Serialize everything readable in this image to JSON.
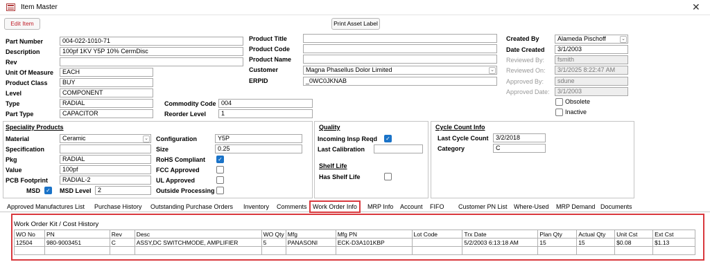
{
  "window": {
    "title": "Item Master",
    "close_icon": "close-icon"
  },
  "buttons": {
    "edit": "Edit Item",
    "print": "Print Asset Label"
  },
  "item": {
    "part_number_label": "Part Number",
    "part_number": "004-022-1010-71",
    "description_label": "Description",
    "description": "100pf 1KV Y5P 10% CermDisc",
    "rev_label": "Rev",
    "rev": "",
    "uom_label": "Unit Of Measure",
    "uom": "EACH",
    "product_class_label": "Product Class",
    "product_class": "BUY",
    "level_label": "Level",
    "level": "COMPONENT",
    "type_label": "Type",
    "type": "RADIAL",
    "part_type_label": "Part Type",
    "part_type": "CAPACITOR",
    "commodity_code_label": "Commodity Code",
    "commodity_code": "004",
    "reorder_level_label": "Reorder Level",
    "reorder_level": "1"
  },
  "product": {
    "title_label": "Product Title",
    "title": "",
    "code_label": "Product Code",
    "code": "",
    "name_label": "Product Name",
    "name": "",
    "customer_label": "Customer",
    "customer": "Magna Phasellus Dolor Limited",
    "erpid_label": "ERPID",
    "erpid": "_0WC0JKNAB"
  },
  "audit": {
    "created_by_label": "Created By",
    "created_by": "Alameda Pischoff",
    "date_created_label": "Date Created",
    "date_created": "3/1/2003",
    "reviewed_by_label": "Reviewed By:",
    "reviewed_by": "fsmith",
    "reviewed_on_label": "Reviewed On:",
    "reviewed_on": "3/1/2025 8:22:47 AM",
    "approved_by_label": "Approved By:",
    "approved_by": "sdune",
    "approved_date_label": "Approved Date:",
    "approved_date": "3/1/2003",
    "obsolete_label": "Obsolete",
    "inactive_label": "Inactive"
  },
  "speciality": {
    "heading": "Speciality Products",
    "material_label": "Material",
    "material": "Ceramic",
    "specification_label": "Specification",
    "specification": "",
    "pkg_label": "Pkg",
    "pkg": "RADIAL",
    "value_label": "Value",
    "value": "100pf",
    "pcb_label": "PCB Footprint",
    "pcb": "RADIAL-2",
    "msd_label": "MSD",
    "msd_level_label": "MSD Level",
    "msd_level": "2",
    "configuration_label": "Configuration",
    "configuration": "Y5P",
    "size_label": "Size",
    "size": "0.25",
    "rohs_label": "RoHS Compliant",
    "fcc_label": "FCC Approved",
    "ul_label": "UL Approved",
    "outside_label": "Outside Processing"
  },
  "quality": {
    "heading": "Quality",
    "incoming_label": "Incoming Insp Reqd",
    "last_calibration_label": "Last Calibration",
    "last_calibration": "",
    "shelf_heading": "Shelf Life",
    "has_shelf_label": "Has Shelf Life"
  },
  "cycle": {
    "heading": "Cycle Count Info",
    "last_count_label": "Last Cycle Count",
    "last_count": "3/2/2018",
    "category_label": "Category",
    "category": "C"
  },
  "tabs": {
    "t0": "Approved Manufactures List",
    "t1": "Purchase History",
    "t2": "Outstanding Purchase Orders",
    "t3": "Inventory",
    "t4": "Comments",
    "t5": "Work Order Info",
    "t6": "MRP Info",
    "t7": "Account",
    "t8": "FIFO",
    "t9": "Customer PN List",
    "t10": "Where-Used",
    "t11": "MRP Demand",
    "t12": "Documents"
  },
  "work_order": {
    "heading": "Work Order Kit / Cost History",
    "columns": [
      "WO No",
      "PN",
      "Rev",
      "Desc",
      "WO Qty",
      "Mfg",
      "Mfg PN",
      "Lot Code",
      "Trx Date",
      "Plan Qty",
      "Actual Qty",
      "Unit Cst",
      "Ext Cst"
    ],
    "row": [
      "12504",
      "980-9003451",
      "C",
      "ASSY,DC SWITCHMODE, AMPLIFIER",
      "5",
      "PANASONI",
      "ECK-D3A101KBP",
      "",
      "5/2/2003 6:13:18 AM",
      "15",
      "15",
      "$0.08",
      "$1.13"
    ]
  }
}
